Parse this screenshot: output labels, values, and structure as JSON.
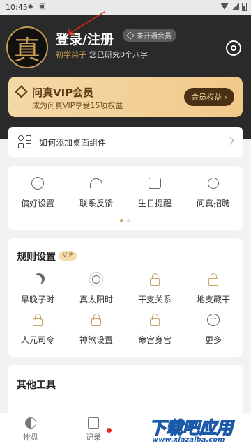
{
  "status_bar": {
    "time": "10:45",
    "icons": [
      "android-icon",
      "notification-icon",
      "wifi-icon",
      "signal-icon",
      "battery-icon"
    ]
  },
  "profile": {
    "avatar_char": "真",
    "login_title": "登录/注册",
    "member_badge": "未开通会员",
    "rank": "初学弟子",
    "study_info": "您已研究0个八字"
  },
  "vip_card": {
    "title": "问真VIP会员",
    "subtitle": "成为问真VIP享受15项权益",
    "button": "会员权益 ›"
  },
  "widget_row": {
    "label": "如何添加桌面组件"
  },
  "quick_grid": {
    "items": [
      {
        "label": "偏好设置",
        "icon": "preferences-icon"
      },
      {
        "label": "联系反馈",
        "icon": "headset-icon"
      },
      {
        "label": "生日提醒",
        "icon": "calendar-icon"
      },
      {
        "label": "问真招聘",
        "icon": "edit-icon"
      }
    ],
    "page_count": 2,
    "active_page": 1
  },
  "rules": {
    "title": "规则设置",
    "tag": "VIP",
    "rows": [
      [
        {
          "label": "早晚子时",
          "icon": "moon-icon"
        },
        {
          "label": "真太阳时",
          "icon": "sun-icon"
        },
        {
          "label": "干支关系",
          "icon": "lock-icon"
        },
        {
          "label": "地支藏干",
          "icon": "lock-icon"
        }
      ],
      [
        {
          "label": "人元司令",
          "icon": "lock-icon"
        },
        {
          "label": "神煞设置",
          "icon": "lock-icon"
        },
        {
          "label": "命宫身宫",
          "icon": "lock-icon"
        },
        {
          "label": "更多",
          "icon": "more-icon",
          "glyph": "···"
        }
      ]
    ]
  },
  "tools": {
    "title": "其他工具"
  },
  "bottom_nav": {
    "items": [
      {
        "label": "排盘"
      },
      {
        "label": "记录"
      }
    ]
  },
  "watermark": {
    "main": "下载吧应用",
    "url": "www.xiazaiba.com"
  },
  "colors": {
    "header_bg": "#2a2a2a",
    "gold": "#c49a53",
    "vip_gradient_start": "#f4d9a8",
    "vip_button_bg": "#4a3015",
    "notification_red": "#e0281e"
  }
}
